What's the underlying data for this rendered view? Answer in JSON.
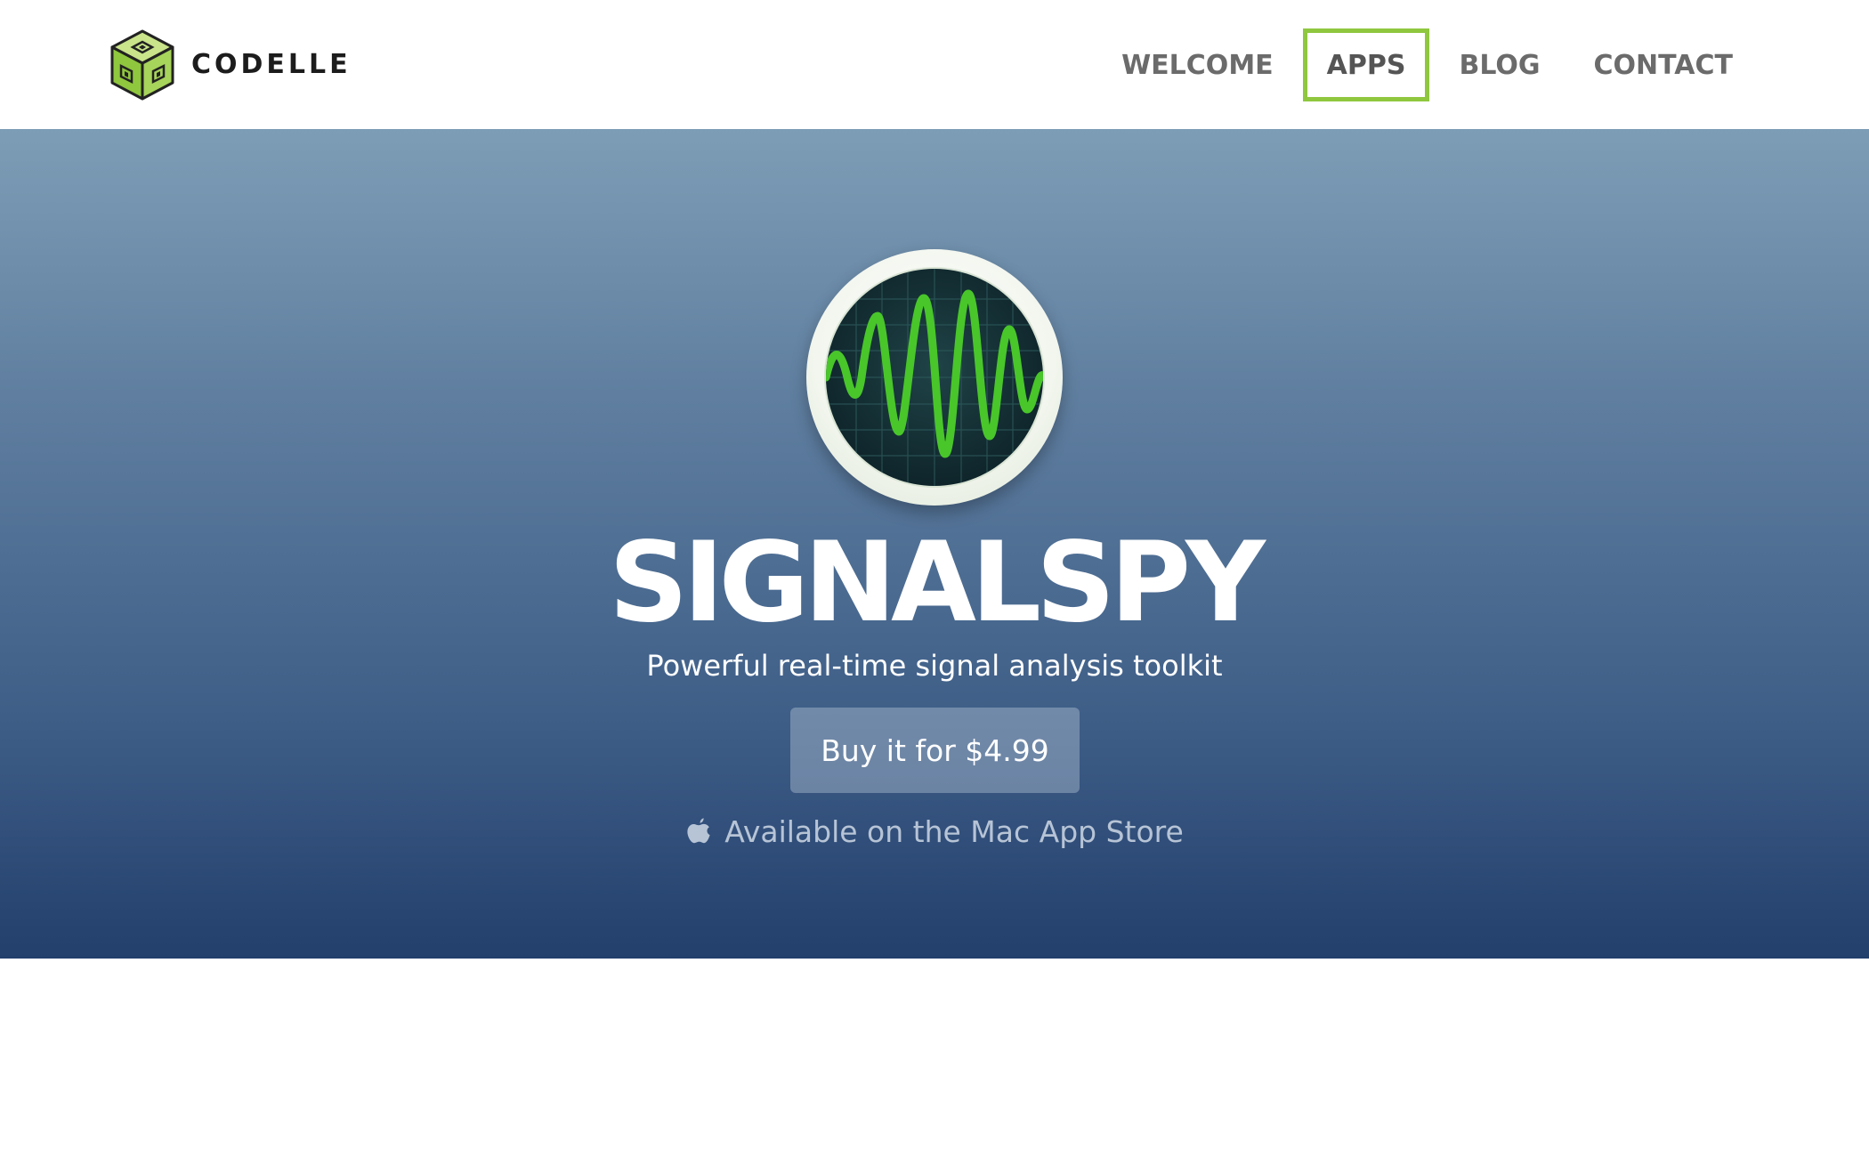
{
  "header": {
    "brand_name": "CODELLE",
    "logo_icon": "cube-logo-icon",
    "nav": [
      {
        "label": "WELCOME",
        "active": false
      },
      {
        "label": "APPS",
        "active": true
      },
      {
        "label": "BLOG",
        "active": false
      },
      {
        "label": "CONTACT",
        "active": false
      }
    ]
  },
  "hero": {
    "app_icon": "oscilloscope-waveform-icon",
    "title": "SIGNALSPY",
    "subtitle": "Powerful real-time signal analysis toolkit",
    "buy_button_label": "Buy it for $4.99",
    "store_icon": "apple-icon",
    "store_text": "Available on the Mac App Store"
  },
  "colors": {
    "nav_active_border": "#8fc73e",
    "nav_text": "#6b6b6b",
    "hero_gradient_top": "#7d9db6",
    "hero_gradient_bottom": "#233f6c",
    "waveform": "#49c62a"
  }
}
